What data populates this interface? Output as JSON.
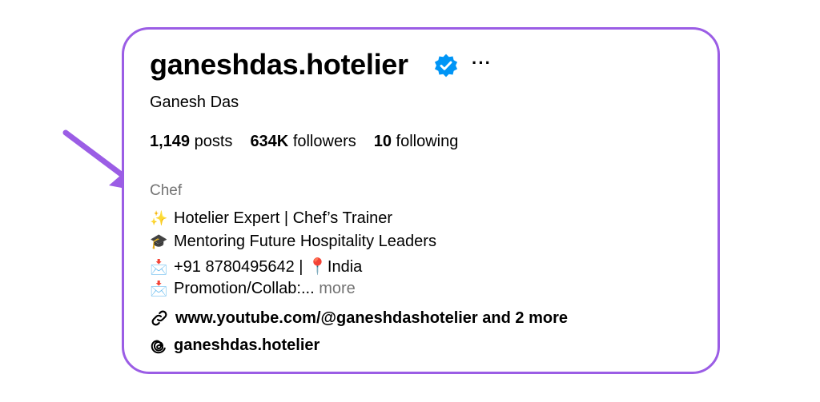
{
  "profile": {
    "username": "ganeshdas.hotelier",
    "full_name": "Ganesh Das",
    "more_options_label": "···",
    "verified_icon": "verified-badge-icon",
    "stats": [
      {
        "count": "1,149",
        "label": "posts"
      },
      {
        "count": "634K",
        "label": "followers"
      },
      {
        "count": "10",
        "label": "following"
      }
    ],
    "category": "Chef",
    "bio": [
      {
        "emoji": "✨",
        "text": "Hotelier Expert | Chef’s Trainer"
      },
      {
        "emoji": "🎓",
        "text": "Mentoring Future Hospitality Leaders"
      },
      {
        "emoji": "📩",
        "text": "+91 8780495642 | 📍India"
      },
      {
        "emoji": "📩",
        "text": "Promotion/Collab:...",
        "more": "more"
      }
    ],
    "link": {
      "icon": "link-icon",
      "text": "www.youtube.com/@ganeshdashotelier and 2 more"
    },
    "threads": {
      "icon": "threads-icon",
      "text": "ganeshdas.hotelier"
    }
  },
  "colors": {
    "card_border": "#9b5de5",
    "arrow": "#9b5de5",
    "verified": "#0095f6",
    "muted_text": "#737373"
  }
}
